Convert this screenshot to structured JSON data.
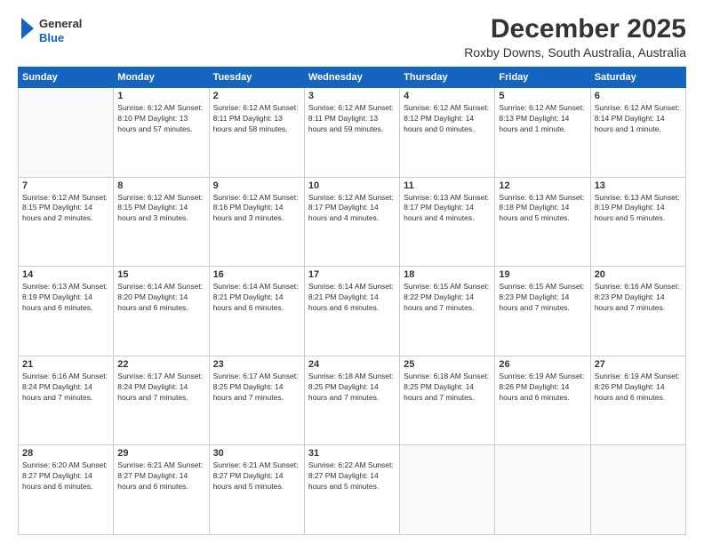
{
  "logo": {
    "line1": "General",
    "line2": "Blue"
  },
  "title": "December 2025",
  "subtitle": "Roxby Downs, South Australia, Australia",
  "weekdays": [
    "Sunday",
    "Monday",
    "Tuesday",
    "Wednesday",
    "Thursday",
    "Friday",
    "Saturday"
  ],
  "weeks": [
    [
      {
        "day": "",
        "info": ""
      },
      {
        "day": "1",
        "info": "Sunrise: 6:12 AM\nSunset: 8:10 PM\nDaylight: 13 hours\nand 57 minutes."
      },
      {
        "day": "2",
        "info": "Sunrise: 6:12 AM\nSunset: 8:11 PM\nDaylight: 13 hours\nand 58 minutes."
      },
      {
        "day": "3",
        "info": "Sunrise: 6:12 AM\nSunset: 8:11 PM\nDaylight: 13 hours\nand 59 minutes."
      },
      {
        "day": "4",
        "info": "Sunrise: 6:12 AM\nSunset: 8:12 PM\nDaylight: 14 hours\nand 0 minutes."
      },
      {
        "day": "5",
        "info": "Sunrise: 6:12 AM\nSunset: 8:13 PM\nDaylight: 14 hours\nand 1 minute."
      },
      {
        "day": "6",
        "info": "Sunrise: 6:12 AM\nSunset: 8:14 PM\nDaylight: 14 hours\nand 1 minute."
      }
    ],
    [
      {
        "day": "7",
        "info": "Sunrise: 6:12 AM\nSunset: 8:15 PM\nDaylight: 14 hours\nand 2 minutes."
      },
      {
        "day": "8",
        "info": "Sunrise: 6:12 AM\nSunset: 8:15 PM\nDaylight: 14 hours\nand 3 minutes."
      },
      {
        "day": "9",
        "info": "Sunrise: 6:12 AM\nSunset: 8:16 PM\nDaylight: 14 hours\nand 3 minutes."
      },
      {
        "day": "10",
        "info": "Sunrise: 6:12 AM\nSunset: 8:17 PM\nDaylight: 14 hours\nand 4 minutes."
      },
      {
        "day": "11",
        "info": "Sunrise: 6:13 AM\nSunset: 8:17 PM\nDaylight: 14 hours\nand 4 minutes."
      },
      {
        "day": "12",
        "info": "Sunrise: 6:13 AM\nSunset: 8:18 PM\nDaylight: 14 hours\nand 5 minutes."
      },
      {
        "day": "13",
        "info": "Sunrise: 6:13 AM\nSunset: 8:19 PM\nDaylight: 14 hours\nand 5 minutes."
      }
    ],
    [
      {
        "day": "14",
        "info": "Sunrise: 6:13 AM\nSunset: 8:19 PM\nDaylight: 14 hours\nand 6 minutes."
      },
      {
        "day": "15",
        "info": "Sunrise: 6:14 AM\nSunset: 8:20 PM\nDaylight: 14 hours\nand 6 minutes."
      },
      {
        "day": "16",
        "info": "Sunrise: 6:14 AM\nSunset: 8:21 PM\nDaylight: 14 hours\nand 6 minutes."
      },
      {
        "day": "17",
        "info": "Sunrise: 6:14 AM\nSunset: 8:21 PM\nDaylight: 14 hours\nand 6 minutes."
      },
      {
        "day": "18",
        "info": "Sunrise: 6:15 AM\nSunset: 8:22 PM\nDaylight: 14 hours\nand 7 minutes."
      },
      {
        "day": "19",
        "info": "Sunrise: 6:15 AM\nSunset: 8:23 PM\nDaylight: 14 hours\nand 7 minutes."
      },
      {
        "day": "20",
        "info": "Sunrise: 6:16 AM\nSunset: 8:23 PM\nDaylight: 14 hours\nand 7 minutes."
      }
    ],
    [
      {
        "day": "21",
        "info": "Sunrise: 6:16 AM\nSunset: 8:24 PM\nDaylight: 14 hours\nand 7 minutes."
      },
      {
        "day": "22",
        "info": "Sunrise: 6:17 AM\nSunset: 8:24 PM\nDaylight: 14 hours\nand 7 minutes."
      },
      {
        "day": "23",
        "info": "Sunrise: 6:17 AM\nSunset: 8:25 PM\nDaylight: 14 hours\nand 7 minutes."
      },
      {
        "day": "24",
        "info": "Sunrise: 6:18 AM\nSunset: 8:25 PM\nDaylight: 14 hours\nand 7 minutes."
      },
      {
        "day": "25",
        "info": "Sunrise: 6:18 AM\nSunset: 8:25 PM\nDaylight: 14 hours\nand 7 minutes."
      },
      {
        "day": "26",
        "info": "Sunrise: 6:19 AM\nSunset: 8:26 PM\nDaylight: 14 hours\nand 6 minutes."
      },
      {
        "day": "27",
        "info": "Sunrise: 6:19 AM\nSunset: 8:26 PM\nDaylight: 14 hours\nand 6 minutes."
      }
    ],
    [
      {
        "day": "28",
        "info": "Sunrise: 6:20 AM\nSunset: 8:27 PM\nDaylight: 14 hours\nand 6 minutes."
      },
      {
        "day": "29",
        "info": "Sunrise: 6:21 AM\nSunset: 8:27 PM\nDaylight: 14 hours\nand 6 minutes."
      },
      {
        "day": "30",
        "info": "Sunrise: 6:21 AM\nSunset: 8:27 PM\nDaylight: 14 hours\nand 5 minutes."
      },
      {
        "day": "31",
        "info": "Sunrise: 6:22 AM\nSunset: 8:27 PM\nDaylight: 14 hours\nand 5 minutes."
      },
      {
        "day": "",
        "info": ""
      },
      {
        "day": "",
        "info": ""
      },
      {
        "day": "",
        "info": ""
      }
    ]
  ]
}
